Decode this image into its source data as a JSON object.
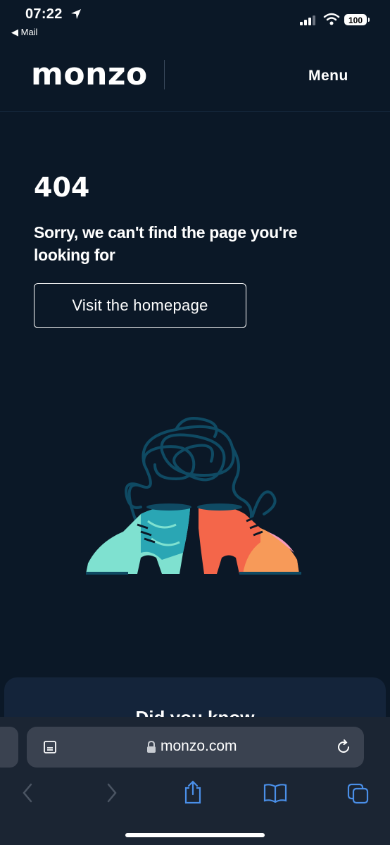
{
  "status_bar": {
    "time": "07:22",
    "back_app": "◀ Mail",
    "battery": "100"
  },
  "header": {
    "logo": "monzo",
    "menu_label": "Menu"
  },
  "main": {
    "error_code": "404",
    "message": "Sorry, we can't find the page you're looking for",
    "home_button_label": "Visit the homepage"
  },
  "card": {
    "heading": "Did you know"
  },
  "browser": {
    "url": "monzo.com"
  },
  "icons": {
    "location": "location-arrow-icon",
    "signal": "cellular-signal-icon",
    "wifi": "wifi-icon",
    "reader": "reader-mode-icon",
    "lock": "lock-icon",
    "reload": "reload-icon",
    "back": "back-chevron-icon",
    "forward": "forward-chevron-icon",
    "share": "share-icon",
    "bookmarks": "bookmarks-icon",
    "tabs": "tabs-icon"
  },
  "colors": {
    "background": "#0b1827",
    "shoe_left": "#7fe1d0",
    "shoe_right": "#f4664a",
    "browser_accent": "#4a8fe8"
  }
}
